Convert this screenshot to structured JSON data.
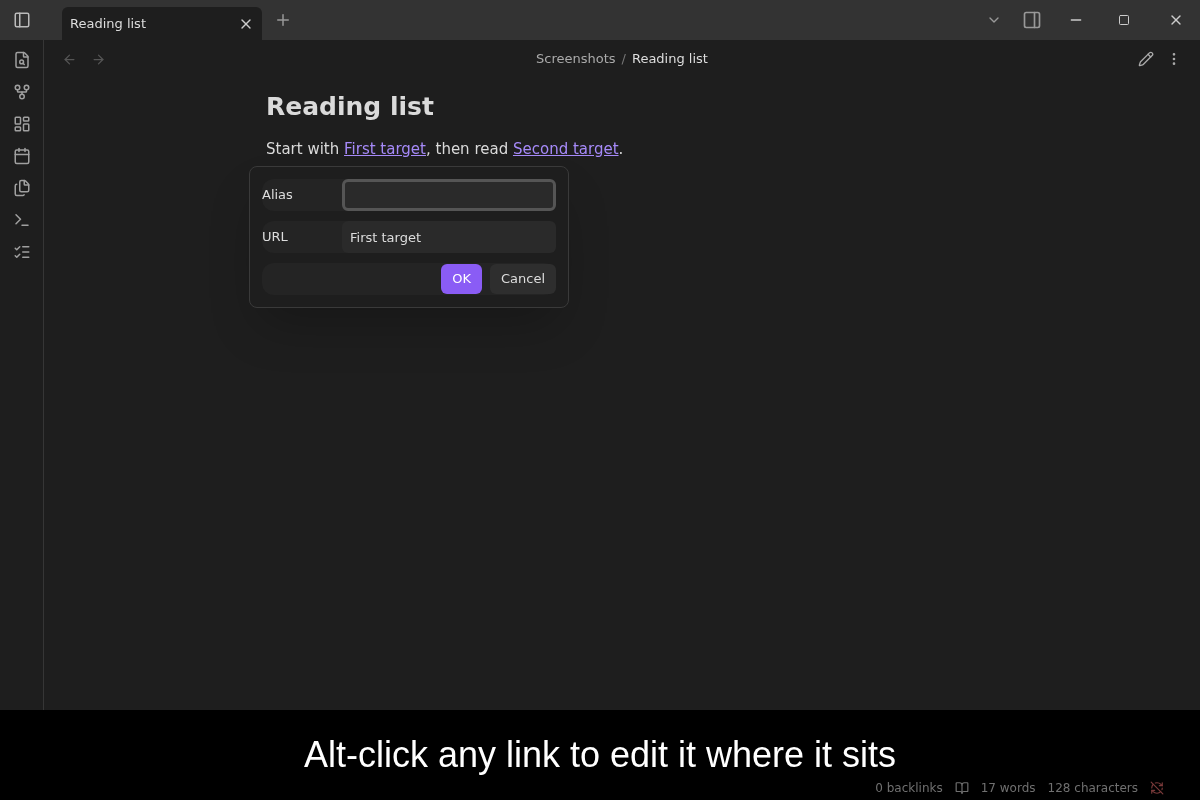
{
  "tabs": [
    {
      "label": "Reading list",
      "selected": true
    }
  ],
  "breadcrumb": {
    "folder": "Screenshots",
    "separator": "/",
    "note": "Reading list"
  },
  "note": {
    "title": "Reading list",
    "paragraph": [
      {
        "kind": "text",
        "text": "Start with "
      },
      {
        "kind": "link",
        "text": "First target"
      },
      {
        "kind": "text",
        "text": ", then read "
      },
      {
        "kind": "link",
        "text": "Second target"
      },
      {
        "kind": "text",
        "text": "."
      }
    ]
  },
  "link_dialog": {
    "fields": [
      {
        "label": "Alias",
        "focused": true
      },
      {
        "label": "URL",
        "value": "First target",
        "focused": false
      }
    ],
    "buttons": [
      {
        "label": "OK",
        "kind": "primary"
      },
      {
        "label": "Cancel",
        "kind": "secondary"
      }
    ]
  },
  "status_bar": {
    "backlinks": "0 backlinks",
    "words": "17 words",
    "characters": "128 characters"
  },
  "caption": "Alt-click any link to edit it where it sits"
}
